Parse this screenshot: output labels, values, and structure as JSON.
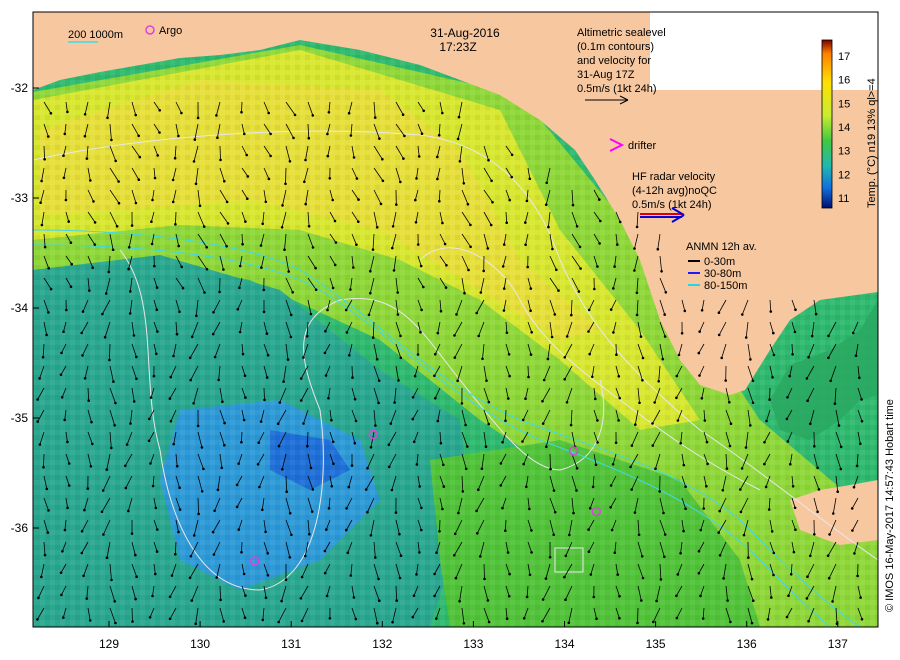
{
  "title": {
    "date": "31-Aug-2016",
    "time": "17:23Z"
  },
  "legend": {
    "scale_label": "200  1000m",
    "argo_label": "Argo",
    "altimetry": [
      "Altimetric sealevel",
      "(0.1m contours)",
      "and velocity for",
      "31-Aug 17Z",
      "0.5m/s (1kt 24h)"
    ],
    "drifter_label": "drifter",
    "hf_radar": [
      "HF radar velocity",
      "(4-12h avg)noQC",
      "0.5m/s (1kt 24h)"
    ],
    "anmn_title": "ANMN 12h av.",
    "anmn_items": [
      {
        "label": "0-30m",
        "color": "#000000"
      },
      {
        "label": "30-80m",
        "color": "#1a1aff"
      },
      {
        "label": "80-150m",
        "color": "#22d6e6"
      }
    ]
  },
  "colorbar": {
    "label": "Temp. (°C) n19 13% ql>=4",
    "ticks": [
      "17",
      "16",
      "15",
      "14",
      "13",
      "12",
      "11"
    ],
    "stops": [
      "#ff7f00",
      "#ffb000",
      "#ffe000",
      "#d8ef30",
      "#60d040",
      "#30c090",
      "#20a0d0",
      "#1050d0",
      "#001080"
    ]
  },
  "axes": {
    "x_ticks": [
      "129",
      "130",
      "131",
      "132",
      "133",
      "134",
      "135",
      "136",
      "137"
    ],
    "y_ticks": [
      "-32",
      "-33",
      "-34",
      "-35",
      "-36"
    ]
  },
  "credit": "© IMOS 16-May-2017 14:57:43 Hobart time",
  "colors": {
    "land": "#f7c8a0",
    "argo": "#e040e0",
    "drifter": "#ff00ff",
    "hf_radar_red": "#e00000",
    "hf_radar_blue": "#0000e0",
    "contour": "#e8e8e8",
    "isobath": "#40d8e8"
  },
  "argo_floats": [
    {
      "lon": 131.9,
      "lat": -35.15
    },
    {
      "lon": 134.1,
      "lat": -35.3
    },
    {
      "lon": 134.35,
      "lat": -35.85
    },
    {
      "lon": 130.6,
      "lat": -36.3
    }
  ]
}
